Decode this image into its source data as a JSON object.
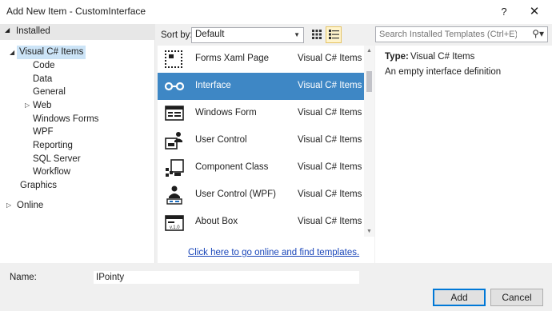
{
  "window": {
    "title": "Add New Item - CustomInterface",
    "help_glyph": "?",
    "close_glyph": "✕"
  },
  "tree": {
    "installed_label": "Installed",
    "root_label": "Visual C# Items",
    "children": [
      "Code",
      "Data",
      "General",
      "Web",
      "Windows Forms",
      "WPF",
      "Reporting",
      "SQL Server",
      "Workflow"
    ],
    "graphics_label": "Graphics",
    "online_label": "Online"
  },
  "toolbar": {
    "sort_label": "Sort by:",
    "sort_value": "Default",
    "search_placeholder": "Search Installed Templates (Ctrl+E)"
  },
  "templates": [
    {
      "name": "Forms Xaml Page",
      "lang": "Visual C# Items",
      "icon": "forms-xaml-page-icon"
    },
    {
      "name": "Interface",
      "lang": "Visual C# Items",
      "icon": "interface-icon",
      "selected": true
    },
    {
      "name": "Windows Form",
      "lang": "Visual C# Items",
      "icon": "windows-form-icon"
    },
    {
      "name": "User Control",
      "lang": "Visual C# Items",
      "icon": "user-control-icon"
    },
    {
      "name": "Component Class",
      "lang": "Visual C# Items",
      "icon": "component-class-icon"
    },
    {
      "name": "User Control (WPF)",
      "lang": "Visual C# Items",
      "icon": "user-control-wpf-icon"
    },
    {
      "name": "About Box",
      "lang": "Visual C# Items",
      "icon": "about-box-icon",
      "icon_text": "v.1.0"
    }
  ],
  "online_link": "Click here to go online and find templates.",
  "details": {
    "type_label": "Type:",
    "type_value": "Visual C# Items",
    "description": "An empty interface definition"
  },
  "name_field": {
    "label": "Name:",
    "value": "IPointy"
  },
  "buttons": {
    "add": "Add",
    "cancel": "Cancel"
  },
  "colors": {
    "selection": "#3e87c5",
    "tree_selection": "#cce4f7",
    "link": "#1a46b9"
  }
}
